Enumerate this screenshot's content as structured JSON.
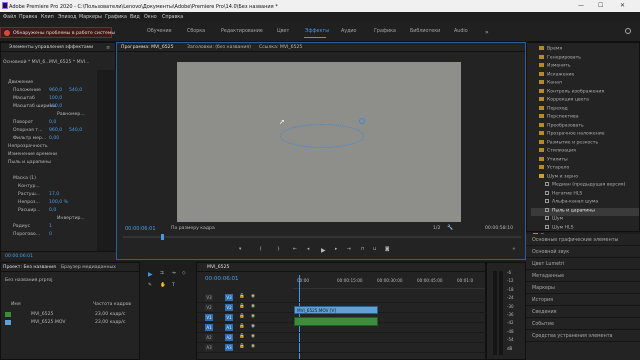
{
  "window": {
    "title": "Adobe Premiere Pro 2020 - C:\\Пользователи\\Lenovo\\Документы\\Adobe\\Premiere Pro\\14.0\\Без названия *",
    "minimize": "—",
    "maximize": "☐",
    "close": "✕"
  },
  "menu": [
    "Файл",
    "Правка",
    "Клип",
    "Эпизод",
    "Маркеры",
    "Графика",
    "Вид",
    "Окно",
    "Справка"
  ],
  "workspaces": {
    "home_icon": "home-icon",
    "tabs": [
      "Обучение",
      "Сборка",
      "Редактирование",
      "Цвет",
      "Эффекты",
      "Аудио",
      "Графика",
      "Библиотеки",
      "Audio"
    ],
    "active_index": 4
  },
  "error_bar": {
    "text": "Обнаружены проблемы в работе системы"
  },
  "effect_controls": {
    "tab_label": "Элементы управления эффектами",
    "source_label": "Основной * MVI_6...",
    "clip_label": "MVI_6525 * MVI...",
    "rows": [
      {
        "label": "Движение",
        "value": "",
        "indent": 1
      },
      {
        "label": "Положение",
        "value": "960,0",
        "value2": "540,0",
        "indent": 2
      },
      {
        "label": "Масштаб",
        "value": "100,0",
        "indent": 2
      },
      {
        "label": "Масштаб ширины",
        "value": "100,0",
        "indent": 2
      },
      {
        "label": "",
        "value": "",
        "check": "Равномер...",
        "indent": 2
      },
      {
        "label": "Поворот",
        "value": "0,0",
        "indent": 2
      },
      {
        "label": "Опорная т...",
        "value": "960,0",
        "value2": "540,0",
        "indent": 2
      },
      {
        "label": "Фильтр мер...",
        "value": "0,00",
        "indent": 2
      },
      {
        "label": "Непрозрачность",
        "value": "",
        "indent": 1
      },
      {
        "label": "Изменение времени",
        "value": "",
        "indent": 1
      },
      {
        "label": "Пыль и царапины",
        "value": "",
        "indent": 1
      },
      {
        "label": "",
        "value": "",
        "indent": 2
      },
      {
        "label": "Маска (1)",
        "value": "",
        "indent": 2
      },
      {
        "label": "Контур...",
        "value": "",
        "indent": 3
      },
      {
        "label": "Растуш...",
        "value": "17,0",
        "indent": 3
      },
      {
        "label": "Непроз...",
        "value": "100,0 %",
        "indent": 3
      },
      {
        "label": "Расшир...",
        "value": "0,0",
        "indent": 3
      },
      {
        "label": "",
        "value": "",
        "check": "Инвертир...",
        "indent": 3
      },
      {
        "label": "Радиус",
        "value": "1",
        "indent": 2
      },
      {
        "label": "Порогово...",
        "value": "0",
        "indent": 2
      }
    ],
    "timecode": "00:00:06:01"
  },
  "program_monitor": {
    "tabs": [
      "Программа: MVI_6525",
      "Заголовки: (без названия)",
      "Ссылка: MVI_6525"
    ],
    "timecode": "00:00:06:01",
    "fit": "По размеру кадра",
    "resolution": "1/2",
    "duration": "00:00:58:10"
  },
  "effects_panel": {
    "items": [
      {
        "label": "Время",
        "type": "folder",
        "indent": 1
      },
      {
        "label": "Генерировать",
        "type": "folder",
        "indent": 1
      },
      {
        "label": "Изменить",
        "type": "folder",
        "indent": 1
      },
      {
        "label": "Искажение",
        "type": "folder",
        "indent": 1
      },
      {
        "label": "Канал",
        "type": "folder",
        "indent": 1
      },
      {
        "label": "Контроль изображения",
        "type": "folder",
        "indent": 1
      },
      {
        "label": "Коррекция цвета",
        "type": "folder",
        "indent": 1
      },
      {
        "label": "Переход",
        "type": "folder",
        "indent": 1
      },
      {
        "label": "Перспектива",
        "type": "folder",
        "indent": 1
      },
      {
        "label": "Преобразовать",
        "type": "folder",
        "indent": 1
      },
      {
        "label": "Прозрачное наложение",
        "type": "folder",
        "indent": 1
      },
      {
        "label": "Размытие и резкость",
        "type": "folder",
        "indent": 1
      },
      {
        "label": "Стилизация",
        "type": "folder",
        "indent": 1
      },
      {
        "label": "Утилиты",
        "type": "folder",
        "indent": 1
      },
      {
        "label": "Устарело",
        "type": "folder",
        "indent": 1
      },
      {
        "label": "Шум и зерно",
        "type": "folder-open",
        "indent": 1
      },
      {
        "label": "Медиан (предыдущая версия)",
        "type": "effect",
        "indent": 2
      },
      {
        "label": "Негатив HLS",
        "type": "effect",
        "indent": 2
      },
      {
        "label": "Альфа-канал шума",
        "type": "effect",
        "indent": 2
      },
      {
        "label": "Пыль и царапины",
        "type": "effect",
        "indent": 2,
        "selected": true
      },
      {
        "label": "Шум",
        "type": "effect",
        "indent": 2
      },
      {
        "label": "Шум HLS",
        "type": "effect",
        "indent": 2
      },
      {
        "label": "Видеопереходы",
        "type": "folder",
        "indent": 0
      }
    ]
  },
  "side_panels": [
    "Основные графические элементы",
    "Основной звук",
    "Цвет Lumetri",
    "Метаданные",
    "Маркеры",
    "История",
    "Сведения",
    "Событие",
    "Средства устранения элемента"
  ],
  "project_panel": {
    "tabs": [
      "Проект: Без названия",
      "Браузер медиаданных"
    ],
    "search_placeholder": "Без названия.prproj",
    "columns": [
      "Имя",
      "Частота кадров"
    ],
    "items": [
      {
        "name": "MVI_6525",
        "fps": "23,00 кадр/с",
        "color": "#3c8c3c"
      },
      {
        "name": "MVI_6525.MOV",
        "fps": "23,00 кадр/с",
        "color": "#5fa0d6"
      }
    ]
  },
  "timeline": {
    "tab": "MVI_6525",
    "timecode": "00:00:06:01",
    "ruler": [
      "00:00",
      "00:00:15:00",
      "00:00:30:00",
      "00:00:45:00",
      "00:01:0"
    ],
    "tracks": [
      {
        "id": "V3",
        "label": "V3"
      },
      {
        "id": "V2",
        "label": "V2"
      },
      {
        "id": "V1",
        "label": "V1"
      },
      {
        "id": "A1",
        "label": "A1"
      },
      {
        "id": "A2",
        "label": "A2"
      },
      {
        "id": "A3",
        "label": "A3"
      }
    ],
    "clips": [
      {
        "label": "MVI_6525.MOV [V]",
        "track": "V1"
      },
      {
        "label": "",
        "track": "A1"
      }
    ]
  },
  "audio_meter": {
    "labels": [
      "-6",
      "-12",
      "-18",
      "-24",
      "-30",
      "-36",
      "-42",
      "-48",
      "-54",
      "dB"
    ]
  },
  "accent": "#3f98e8"
}
